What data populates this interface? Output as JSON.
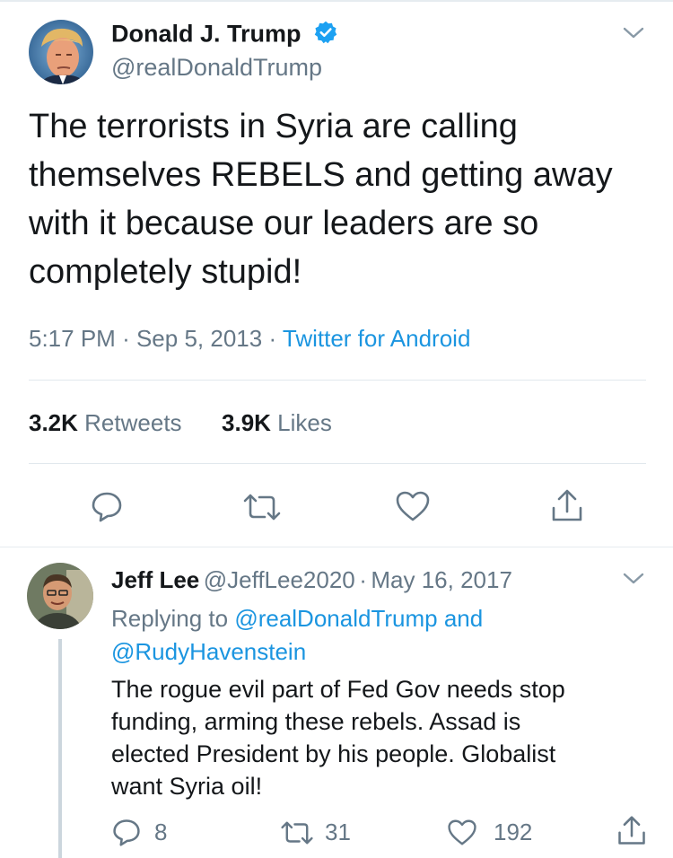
{
  "main_tweet": {
    "author_name": "Donald J. Trump",
    "author_handle": "@realDonaldTrump",
    "text_lines": [
      "The terrorists in Syria are calling",
      "themselves REBELS and getting away",
      "with it because our leaders are so",
      "completely stupid!"
    ],
    "time": "5:17 PM",
    "date": "Sep 5, 2013",
    "source": "Twitter for Android",
    "retweets_count": "3.2K",
    "retweets_label": "Retweets",
    "likes_count": "3.9K",
    "likes_label": "Likes"
  },
  "reply": {
    "author_name": "Jeff Lee",
    "author_handle": "@JeffLee2020",
    "date": "May 16, 2017",
    "replying_to_prefix": "Replying to",
    "replying_to_user1": "@realDonaldTrump",
    "replying_to_and": "and",
    "replying_to_user2": "@RudyHavenstein",
    "text_lines": [
      "The rogue evil part of Fed Gov needs stop",
      "funding, arming these rebels. Assad is",
      "elected President by his people. Globalist",
      "want Syria oil!"
    ],
    "reply_count": "8",
    "retweet_count": "31",
    "like_count": "192"
  },
  "separators": {
    "dot": "·"
  },
  "icons": {
    "verified": "verified-badge-icon",
    "chevron": "chevron-down-icon",
    "reply": "reply-icon",
    "retweet": "retweet-icon",
    "like": "heart-icon",
    "share": "share-icon"
  },
  "colors": {
    "accent": "#1b95e0",
    "secondary_text": "#657786",
    "primary_text": "#14171a",
    "divider": "#e1e8ed"
  }
}
